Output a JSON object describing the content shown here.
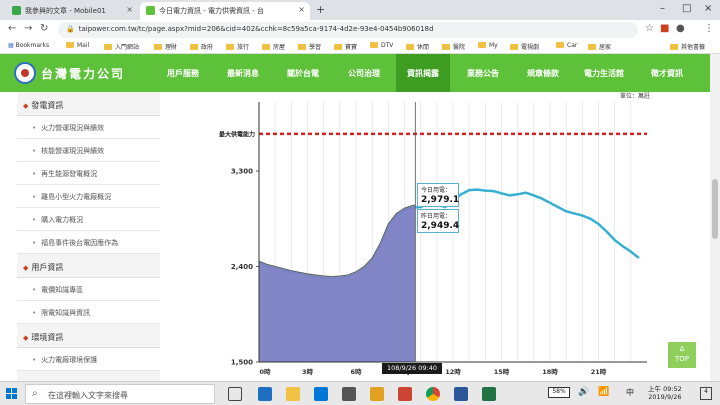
{
  "browser": {
    "tabs": [
      {
        "title": "我參與的文章 - Mobile01",
        "icon_color": "#3aa64a"
      },
      {
        "title": "今日電力資訊 - 電力供需資訊 - 台",
        "icon_color": "#5ec13a"
      }
    ],
    "url": "taipower.com.tw/tc/page.aspx?mid=206&cid=402&cchk=8c59a5ca-9174-4d2e-93e4-0454b906018d",
    "bookmarks": [
      "Bookmarks",
      "Mail",
      "入門網站",
      "理財",
      "政府",
      "旅行",
      "房屋",
      "學習",
      "寶寶",
      "DTV",
      "休閒",
      "醫院",
      "My",
      "電視劇",
      "Car",
      "居家",
      "其他書籤"
    ]
  },
  "site": {
    "logo_text": "台灣電力公司",
    "nav": [
      "用戶服務",
      "最新消息",
      "關於台電",
      "公司治理",
      "資訊揭露",
      "業務公告",
      "規章條款",
      "電力生活館",
      "徵才資訊"
    ],
    "active_nav": "資訊揭露"
  },
  "sidebar": [
    {
      "type": "group",
      "label": "發電資訊"
    },
    {
      "type": "item",
      "label": "火力營運現況與績效"
    },
    {
      "type": "item",
      "label": "核能營運現況與績效"
    },
    {
      "type": "item",
      "label": "再生能源發電概況"
    },
    {
      "type": "item",
      "label": "離島小型火力電廠概況"
    },
    {
      "type": "item",
      "label": "購入電力概況"
    },
    {
      "type": "item",
      "label": "福島事件後台電因應作為"
    },
    {
      "type": "group",
      "label": "用戶資訊"
    },
    {
      "type": "item",
      "label": "電價知識專區"
    },
    {
      "type": "item",
      "label": "限電知識與資訊"
    },
    {
      "type": "group",
      "label": "環境資訊"
    },
    {
      "type": "item",
      "label": "火力電廠環境保護"
    }
  ],
  "main": {
    "unit_label": "單位：萬瓩"
  },
  "chart_data": {
    "type": "area",
    "max_supply_label": "最大供電能力",
    "max_supply_value": 3650,
    "ylim": [
      1500,
      3950
    ],
    "y_ticks": [
      "1,500",
      "2,400",
      "3,300"
    ],
    "y_tick_values": [
      1500,
      2400,
      3300
    ],
    "x_ticks": [
      "0時",
      "3時",
      "6時",
      "9時",
      "12時",
      "15時",
      "18時",
      "21時"
    ],
    "x_tick_hours": [
      0,
      3,
      6,
      9,
      12,
      15,
      18,
      21
    ],
    "xlim": [
      0,
      24
    ],
    "cursor_hour": 9.67,
    "cursor_label": "108/9/26 09:40",
    "today_label": "今日用電：",
    "today_value": "2,979.1",
    "yesterday_label": "昨日用電：",
    "yesterday_value": "2,949.4",
    "series": [
      {
        "name": "今日用電",
        "color": "#7b7fc4",
        "hours": [
          0,
          0.5,
          1,
          1.5,
          2,
          2.5,
          3,
          3.5,
          4,
          4.5,
          5,
          5.5,
          6,
          6.5,
          7,
          7.5,
          8,
          8.5,
          9,
          9.5,
          9.67
        ],
        "values": [
          2450,
          2420,
          2400,
          2380,
          2360,
          2345,
          2330,
          2320,
          2310,
          2305,
          2310,
          2320,
          2350,
          2400,
          2480,
          2620,
          2800,
          2900,
          2950,
          2975,
          2979
        ]
      },
      {
        "name": "昨日用電",
        "color": "#36b0d0",
        "hours": [
          0,
          0.5,
          1,
          1.5,
          2,
          2.5,
          3,
          3.5,
          4,
          4.5,
          5,
          5.5,
          6,
          6.5,
          7,
          7.5,
          8,
          8.5,
          9,
          9.5,
          10,
          10.5,
          11,
          11.5,
          12,
          12.5,
          13,
          13.5,
          14,
          14.5,
          15,
          15.5,
          16,
          16.5,
          17,
          17.5,
          18,
          18.5,
          19,
          19.5,
          20,
          20.5,
          21,
          21.5,
          22,
          22.5,
          23,
          23.5
        ],
        "values": [
          2440,
          2410,
          2385,
          2365,
          2350,
          2335,
          2320,
          2310,
          2300,
          2295,
          2300,
          2310,
          2340,
          2390,
          2470,
          2600,
          2780,
          2880,
          2930,
          2955,
          2960,
          3000,
          2990,
          2960,
          3020,
          3080,
          3120,
          3125,
          3115,
          3110,
          3090,
          3070,
          3080,
          3095,
          3070,
          3040,
          3000,
          2960,
          2920,
          2900,
          2880,
          2850,
          2800,
          2730,
          2650,
          2590,
          2540,
          2480
        ]
      }
    ]
  },
  "ui": {
    "top_button": "TOP",
    "top_arrow": "Δ"
  },
  "taskbar": {
    "search_placeholder": "在這裡輸入文字來搜尋",
    "battery": "58%",
    "lang": "中",
    "time": "上午 09:52",
    "date": "2019/9/26",
    "notifications": "4"
  }
}
